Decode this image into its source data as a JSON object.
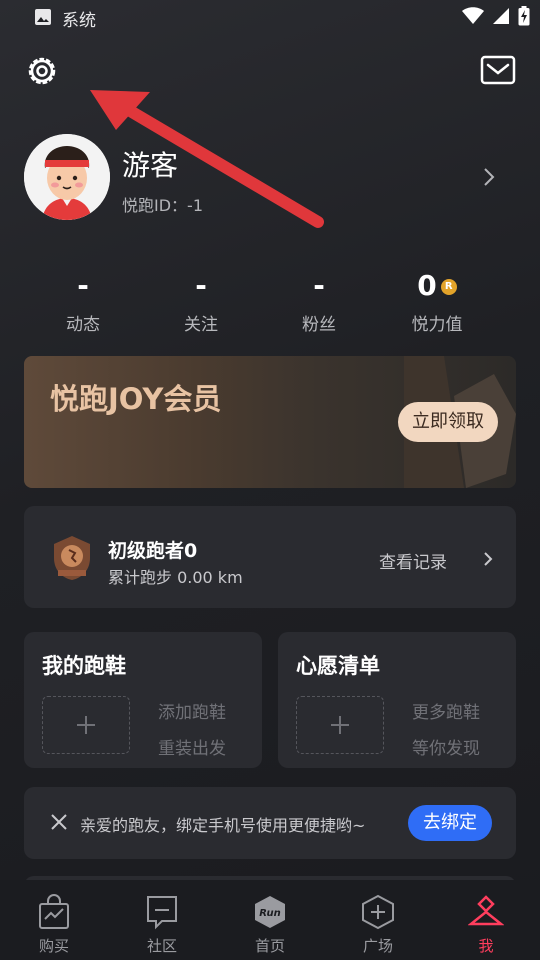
{
  "status_bar": {
    "app_title": "系统"
  },
  "profile": {
    "name": "游客",
    "user_id": "悦跑ID：-1"
  },
  "stats": [
    {
      "value": "-",
      "label": "动态"
    },
    {
      "value": "-",
      "label": "关注"
    },
    {
      "value": "-",
      "label": "粉丝"
    },
    {
      "value": "0",
      "label": "悦力值"
    }
  ],
  "coin_symbol": "R",
  "membership": {
    "title": "悦跑JOY会员",
    "button": "立即领取"
  },
  "runner": {
    "level": "初级跑者0",
    "distance": "累计跑步 0.00 km",
    "records_link": "查看记录"
  },
  "shoes": {
    "title": "我的跑鞋",
    "line1": "添加跑鞋",
    "line2": "重装出发"
  },
  "wishlist": {
    "title": "心愿清单",
    "line1": "更多跑鞋",
    "line2": "等你发现"
  },
  "bind_phone": {
    "message": "亲爱的跑友，绑定手机号使用更便捷哟~",
    "button": "去绑定"
  },
  "tabs": [
    {
      "label": "购买",
      "icon": "shopping-bag-icon"
    },
    {
      "label": "社区",
      "icon": "chat-icon"
    },
    {
      "label": "首页",
      "icon": "run-home-icon"
    },
    {
      "label": "广场",
      "icon": "plaza-icon"
    },
    {
      "label": "我",
      "icon": "profile-icon",
      "active": true
    }
  ],
  "colors": {
    "accent_blue": "#2f6df6",
    "active_tab": "#ff3e5e",
    "annotation_arrow": "#e0373b"
  }
}
